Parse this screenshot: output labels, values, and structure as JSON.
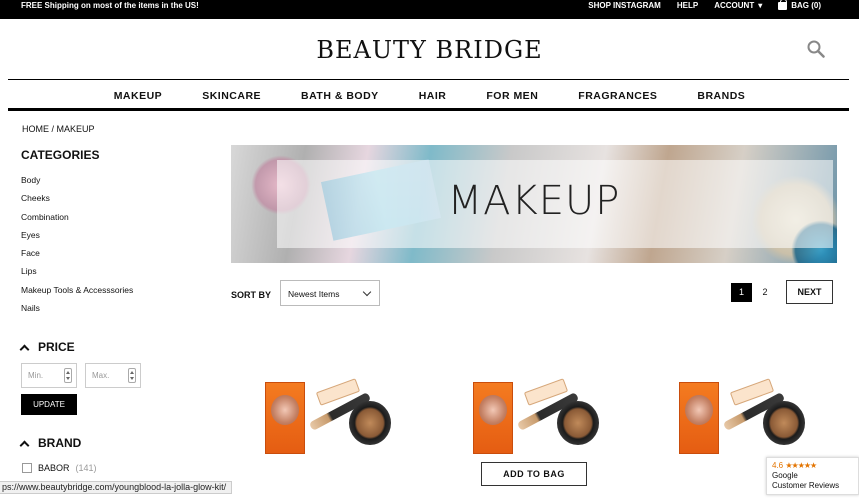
{
  "topbar": {
    "promo": "FREE Shipping on most of the items in the US!",
    "shop_instagram": "SHOP INSTAGRAM",
    "help": "HELP",
    "account": "ACCOUNT",
    "account_caret": "▾",
    "bag": "BAG (0)"
  },
  "header": {
    "logo": "BEAUTY BRIDGE"
  },
  "nav": {
    "items": [
      "MAKEUP",
      "SKINCARE",
      "BATH & BODY",
      "HAIR",
      "FOR MEN",
      "FRAGRANCES",
      "BRANDS"
    ]
  },
  "breadcrumb": "HOME / MAKEUP",
  "sidebar": {
    "categories_title": "CATEGORIES",
    "categories": [
      "Body",
      "Cheeks",
      "Combination",
      "Eyes",
      "Face",
      "Lips",
      "Makeup Tools & Accesssories",
      "Nails"
    ],
    "price_title": "PRICE",
    "min_placeholder": "Min.",
    "max_placeholder": "Max.",
    "update_label": "UPDATE",
    "brand_title": "BRAND",
    "brand_item": {
      "name": "BABOR",
      "count": "(141)"
    }
  },
  "banner": {
    "title": "MAKEUP"
  },
  "toolbar": {
    "sort_label": "SORT BY",
    "sort_value": "Newest Items",
    "page_1": "1",
    "page_2": "2",
    "next_label": "NEXT"
  },
  "products": {
    "add_to_bag": "ADD TO BAG"
  },
  "status_bar": {
    "url": "ps://www.beautybridge.com/youngblood-la-jolla-glow-kit/"
  },
  "google_badge": {
    "rating": "4.6",
    "stars": "★★★★★",
    "brand": "Google",
    "label": "Customer Reviews"
  },
  "colors": {
    "topbar_bg": "#000000",
    "product_box": "#f47b20",
    "rating": "#e37400"
  }
}
